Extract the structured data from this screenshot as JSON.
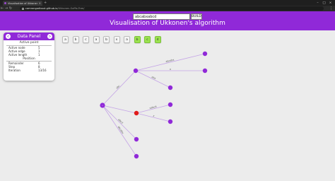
{
  "browser": {
    "tab_title": "Visualisation of Ukkonen's algo...",
    "url_host": "camrongodbout.github.io",
    "url_path": "/Ukkonen-Suffix-Tree/"
  },
  "header": {
    "input_value": "abcabxabcd",
    "build_label": "BUILD",
    "title": "Visualisation of Ukkonen's algorithm"
  },
  "panel": {
    "title": "Data Panel",
    "left_btn": "<",
    "right_btn": ">",
    "active_point_title": "Active point",
    "active_node_label": "Active node",
    "active_node_value": "5",
    "active_edge_label": "Active edge",
    "active_edge_value": "1",
    "active_length_label": "Active length",
    "active_length_value": "1",
    "position_title": "Position",
    "remainder_label": "Remainder",
    "remainder_value": "6",
    "step_label": "Step",
    "step_value": "8",
    "iteration_label": "Iteration",
    "iteration_value": "13/16"
  },
  "chars": [
    {
      "c": "a",
      "active": false
    },
    {
      "c": "b",
      "active": false
    },
    {
      "c": "c",
      "active": false
    },
    {
      "c": "a",
      "active": false
    },
    {
      "c": "b",
      "active": false
    },
    {
      "c": "x",
      "active": false
    },
    {
      "c": "a",
      "active": false
    },
    {
      "c": "b",
      "active": true
    },
    {
      "c": "c",
      "active": true
    },
    {
      "c": "d",
      "active": true
    }
  ],
  "tree": {
    "edge_labels": [
      "abcabx",
      "x",
      "abx",
      "abc",
      "xabcd",
      "x",
      "abcabx",
      "abcd"
    ],
    "colors": {
      "node": "#9029d8",
      "active_node": "#e01b1b",
      "edge": "#c4a4e6"
    }
  }
}
